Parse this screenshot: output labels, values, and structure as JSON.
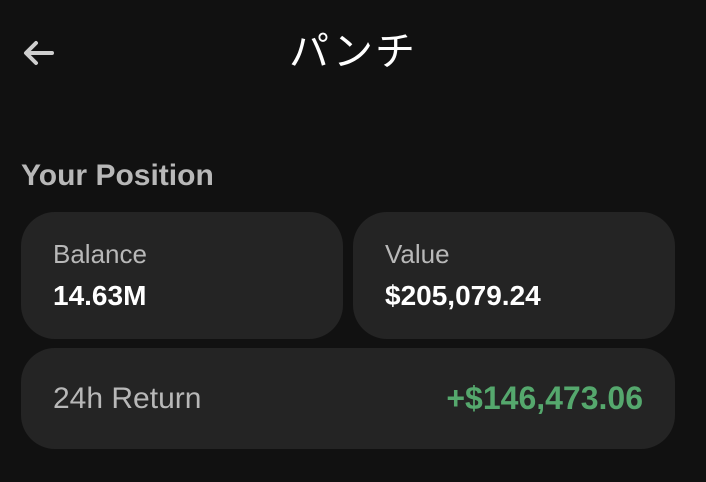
{
  "header": {
    "back_icon": "arrow-left-icon",
    "title": "パンチ"
  },
  "position": {
    "section_title": "Your Position",
    "balance": {
      "label": "Balance",
      "value": "14.63M"
    },
    "value": {
      "label": "Value",
      "value": "$205,079.24"
    },
    "return_24h": {
      "label": "24h Return",
      "value": "+$146,473.06",
      "color": "#55a86d"
    }
  },
  "colors": {
    "background": "#111111",
    "card": "#242424",
    "muted_text": "#b8b8b8",
    "positive": "#55a86d"
  }
}
